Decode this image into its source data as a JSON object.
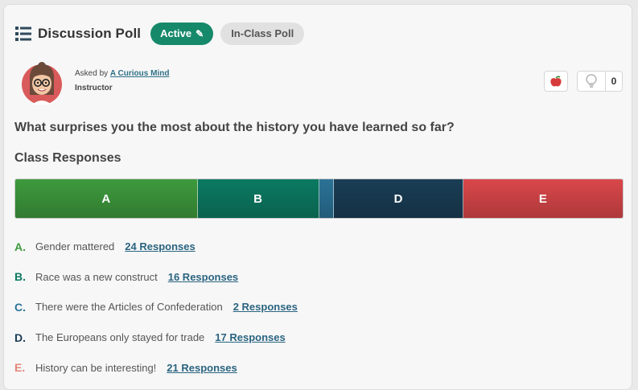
{
  "header": {
    "title": "Discussion Poll",
    "status_badge": "Active",
    "mode_badge": "In-Class Poll"
  },
  "author": {
    "asked_by_prefix": "Asked by",
    "name": "A Curious Mind",
    "role": "Instructor"
  },
  "actions": {
    "apple_icon": "apple-icon",
    "idea_icon": "lightbulb-icon",
    "idea_count": "0"
  },
  "question": "What surprises you the most about the history you have learned so far?",
  "responses_title": "Class Responses",
  "options": [
    {
      "letter": "A",
      "text": "Gender mattered",
      "responses": "24 Responses",
      "count": 24,
      "color": "#3e9a3d"
    },
    {
      "letter": "B",
      "text": "Race was a new construct",
      "responses": "16 Responses",
      "count": 16,
      "color": "#0b7a62"
    },
    {
      "letter": "C",
      "text": "There were the Articles of Confederation",
      "responses": "2 Responses",
      "count": 2,
      "color": "#2b7397"
    },
    {
      "letter": "D",
      "text": "The Europeans only stayed for trade",
      "responses": "17 Responses",
      "count": 17,
      "color": "#1a3d55"
    },
    {
      "letter": "E",
      "text": "History can be interesting!",
      "responses": "21 Responses",
      "count": 21,
      "color": "#d9474a"
    }
  ],
  "letter_colors": [
    "#3e9a3d",
    "#0b7a62",
    "#2b7397",
    "#1a3d55",
    "#e58477"
  ]
}
